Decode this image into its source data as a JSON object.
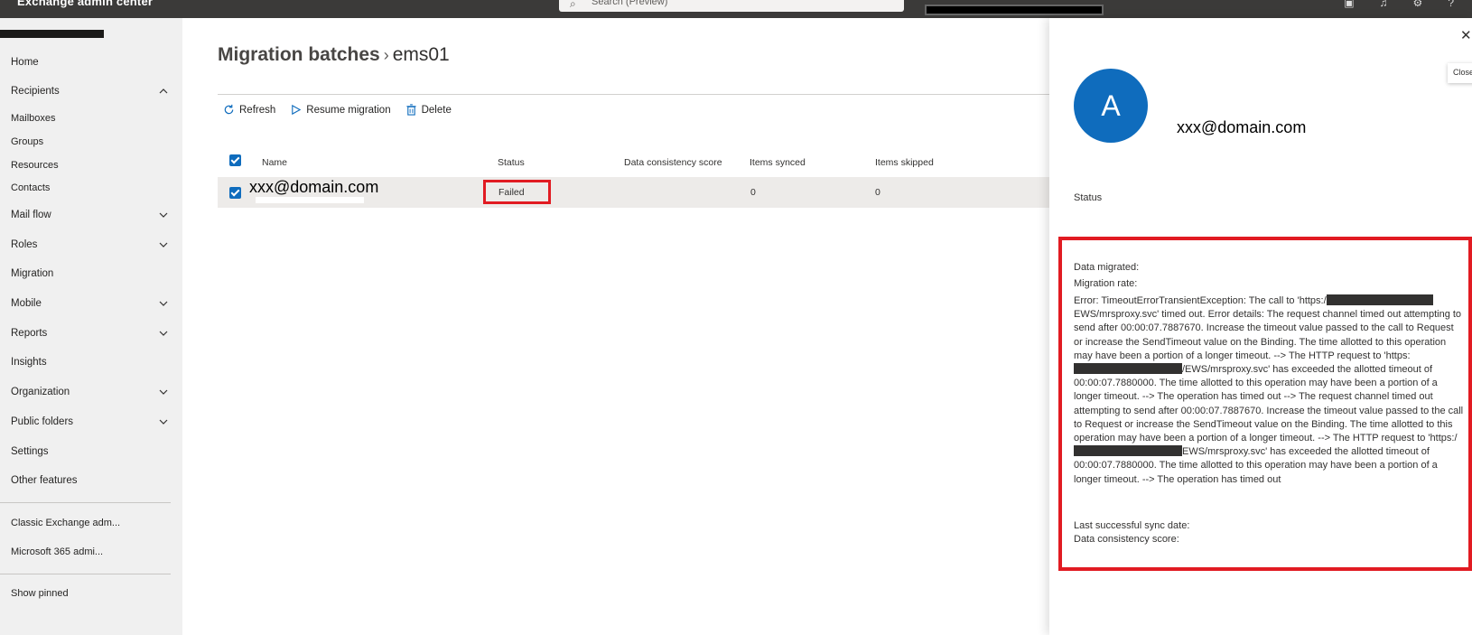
{
  "header": {
    "app_title": "Exchange admin center",
    "search_placeholder": "Search (Preview)"
  },
  "sidebar": {
    "items": [
      {
        "label": "Home"
      },
      {
        "label": "Recipients"
      },
      {
        "label": "Mailboxes"
      },
      {
        "label": "Groups"
      },
      {
        "label": "Resources"
      },
      {
        "label": "Contacts"
      },
      {
        "label": "Mail flow"
      },
      {
        "label": "Roles"
      },
      {
        "label": "Migration"
      },
      {
        "label": "Mobile"
      },
      {
        "label": "Reports"
      },
      {
        "label": "Insights"
      },
      {
        "label": "Organization"
      },
      {
        "label": "Public folders"
      },
      {
        "label": "Settings"
      },
      {
        "label": "Other features"
      },
      {
        "label": "Classic Exchange adm..."
      },
      {
        "label": "Microsoft 365 admi..."
      },
      {
        "label": "Show pinned"
      }
    ]
  },
  "main": {
    "breadcrumb_parent": "Migration batches",
    "breadcrumb_separator": "›",
    "breadcrumb_current": "ems01",
    "toolbar": {
      "refresh": "Refresh",
      "resume": "Resume migration",
      "delete": "Delete"
    },
    "table": {
      "columns": [
        "Name",
        "Status",
        "Data consistency score",
        "Items synced",
        "Items skipped"
      ],
      "rows": [
        {
          "name": "xxx@domain.com",
          "status": "Failed",
          "data_consistency_score": "",
          "items_synced": "0",
          "items_skipped": "0"
        }
      ]
    }
  },
  "panel": {
    "avatar_initial": "A",
    "email": "xxx@domain.com",
    "close_tooltip": "Close",
    "status_label": "Status",
    "data_migrated": "Data migrated:",
    "migration_rate": "Migration rate:",
    "error_parts": [
      "Error: TimeoutErrorTransientException: The call to 'https:/",
      "EWS/mrsproxy.svc' timed out. Error details: The request channel timed out attempting to send after 00:00:07.7887670. Increase the timeout value passed to the call to Request or increase the SendTimeout value on the Binding. The time allotted to this operation may have been a portion of a longer timeout. --> The HTTP request to 'https:",
      "/EWS/mrsproxy.svc' has exceeded the allotted timeout of 00:00:07.7880000. The time allotted to this operation may have been a portion of a longer timeout. --> The operation has timed out --> The request channel timed out attempting to send after 00:00:07.7887670. Increase the timeout value passed to the call to Request or increase the SendTimeout value on the Binding. The time allotted to this operation may have been a portion of a longer timeout. --> The HTTP request to 'https:/",
      "EWS/mrsproxy.svc' has exceeded the allotted timeout of 00:00:07.7880000. The time allotted to this operation may have been a portion of a longer timeout. --> The operation has timed out"
    ],
    "last_sync": "Last successful sync date:",
    "data_consistency": "Data consistency score:"
  },
  "colors": {
    "accent": "#0f6cbd",
    "highlight_red": "#e11b22",
    "topbar": "#3b3a39",
    "sidebar_bg": "#f0f0f0"
  }
}
